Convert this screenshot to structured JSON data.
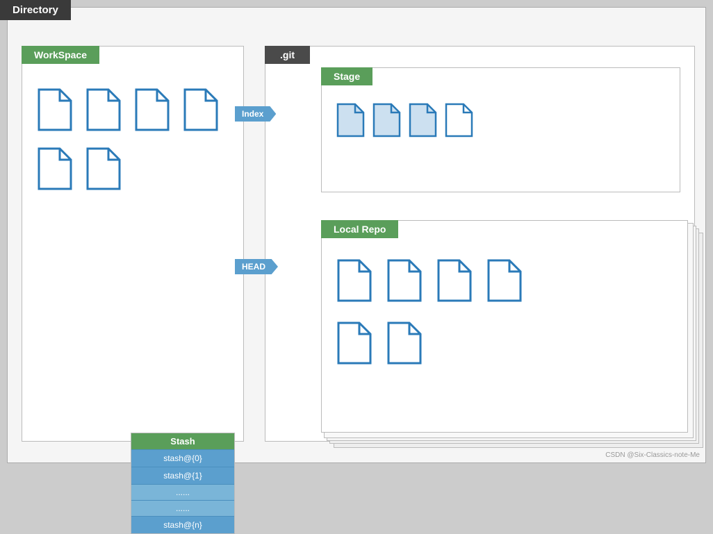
{
  "title": "Directory",
  "workspace": {
    "label": "WorkSpace",
    "file_count": 6
  },
  "git": {
    "label": ".git",
    "index_arrow": "Index",
    "stage": {
      "label": "Stage",
      "file_count": 4
    },
    "head_arrow": "HEAD",
    "local_repo": {
      "label": "Local Repo",
      "row1_count": 4,
      "row2_count": 2
    },
    "stash": {
      "label": "Stash",
      "items": [
        "stash@{0}",
        "stash@{1}",
        "......",
        "......",
        "stash@{n}"
      ]
    }
  },
  "watermark": "CSDN @Six-Classics-note-Me"
}
